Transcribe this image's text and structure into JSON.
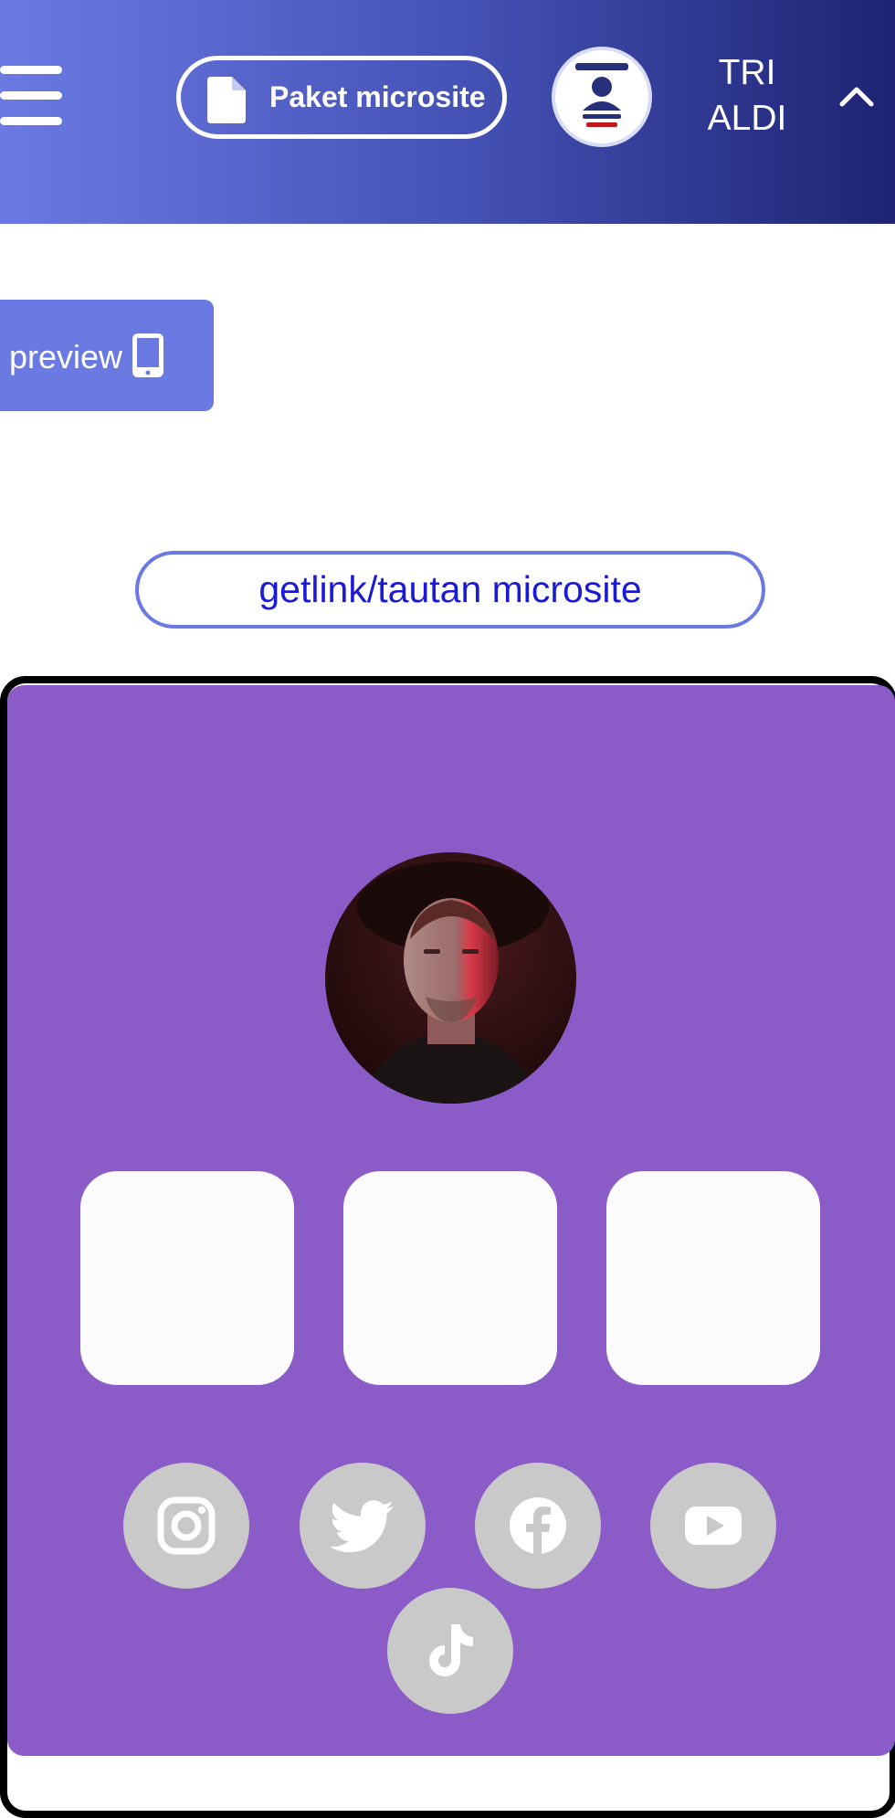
{
  "header": {
    "paket_label": "Paket microsite",
    "user_name": "TRI ALDI",
    "gradient": [
      "#6b79e3",
      "#1e2473"
    ]
  },
  "toolbar": {
    "preview_label": "preview",
    "getlink_label": "getlink/tautan microsite"
  },
  "microsite": {
    "background": "#8b5cc8",
    "link_tiles": 3,
    "social_icons": [
      "instagram-icon",
      "twitter-icon",
      "facebook-icon",
      "youtube-icon",
      "tiktok-icon"
    ]
  },
  "colors": {
    "accent": "#6b79e3",
    "link_text": "#1a1ad6",
    "icon_bg": "#c9c9c9"
  }
}
